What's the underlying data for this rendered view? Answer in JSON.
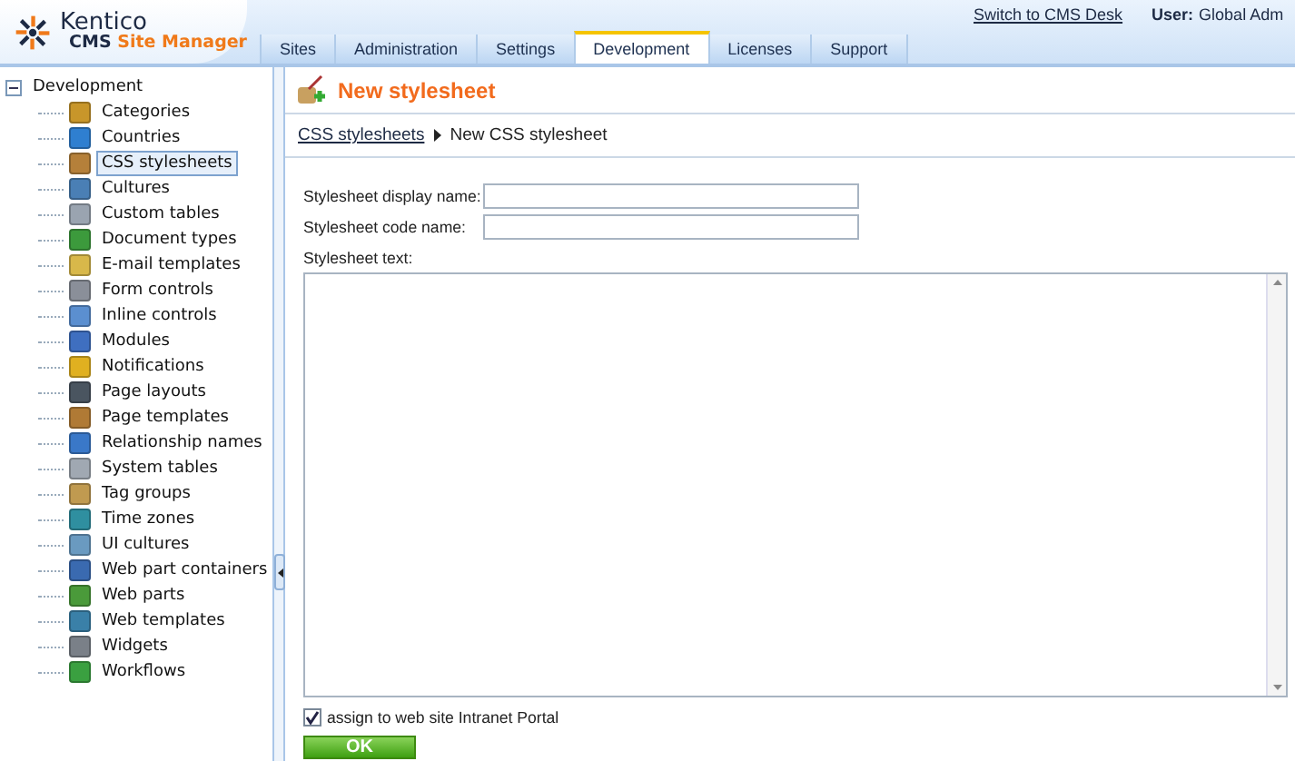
{
  "logo": {
    "brand": "Kentico",
    "product_prefix": "CMS",
    "product": "Site Manager"
  },
  "tabs": [
    {
      "label": "Sites",
      "selected": false
    },
    {
      "label": "Administration",
      "selected": false
    },
    {
      "label": "Settings",
      "selected": false
    },
    {
      "label": "Development",
      "selected": true
    },
    {
      "label": "Licenses",
      "selected": false
    },
    {
      "label": "Support",
      "selected": false
    }
  ],
  "top_links": {
    "switch": "Switch to CMS Desk",
    "user_label": "User:",
    "user_name": "Global Adm"
  },
  "tree": {
    "label": "Development",
    "expanded": true,
    "children": [
      {
        "label": "Categories",
        "selected": false,
        "color": "#c8962a"
      },
      {
        "label": "Countries",
        "selected": false,
        "color": "#2f7fd0"
      },
      {
        "label": "CSS stylesheets",
        "selected": true,
        "color": "#b5803a"
      },
      {
        "label": "Cultures",
        "selected": false,
        "color": "#4a7fb5"
      },
      {
        "label": "Custom tables",
        "selected": false,
        "color": "#9aa4b0"
      },
      {
        "label": "Document types",
        "selected": false,
        "color": "#3c9a3c"
      },
      {
        "label": "E-mail templates",
        "selected": false,
        "color": "#d8b84a"
      },
      {
        "label": "Form controls",
        "selected": false,
        "color": "#8a8f99"
      },
      {
        "label": "Inline controls",
        "selected": false,
        "color": "#5b8fd0"
      },
      {
        "label": "Modules",
        "selected": false,
        "color": "#3f6fc0"
      },
      {
        "label": "Notifications",
        "selected": false,
        "color": "#e0b020"
      },
      {
        "label": "Page layouts",
        "selected": false,
        "color": "#4a5560"
      },
      {
        "label": "Page templates",
        "selected": false,
        "color": "#b07a35"
      },
      {
        "label": "Relationship names",
        "selected": false,
        "color": "#3a78c8"
      },
      {
        "label": "System tables",
        "selected": false,
        "color": "#a0a8b2"
      },
      {
        "label": "Tag groups",
        "selected": false,
        "color": "#c09a50"
      },
      {
        "label": "Time zones",
        "selected": false,
        "color": "#2f8fa0"
      },
      {
        "label": "UI cultures",
        "selected": false,
        "color": "#6a9ac0"
      },
      {
        "label": "Web part containers",
        "selected": false,
        "color": "#3a6ab0"
      },
      {
        "label": "Web parts",
        "selected": false,
        "color": "#4a9a3a"
      },
      {
        "label": "Web templates",
        "selected": false,
        "color": "#3a80a8"
      },
      {
        "label": "Widgets",
        "selected": false,
        "color": "#7a8088"
      },
      {
        "label": "Workflows",
        "selected": false,
        "color": "#3aa040"
      }
    ]
  },
  "page_title": "New stylesheet",
  "breadcrumbs": [
    {
      "label": "CSS stylesheets",
      "kind": "link"
    },
    {
      "label": "New CSS stylesheet",
      "kind": "current"
    }
  ],
  "form": {
    "fields": [
      {
        "label": "Stylesheet display name:"
      },
      {
        "label": "Stylesheet code name:"
      }
    ],
    "text_label": "Stylesheet text:",
    "assign": {
      "label": "assign to web site Intranet Portal",
      "checked": true
    },
    "submit": "OK"
  }
}
